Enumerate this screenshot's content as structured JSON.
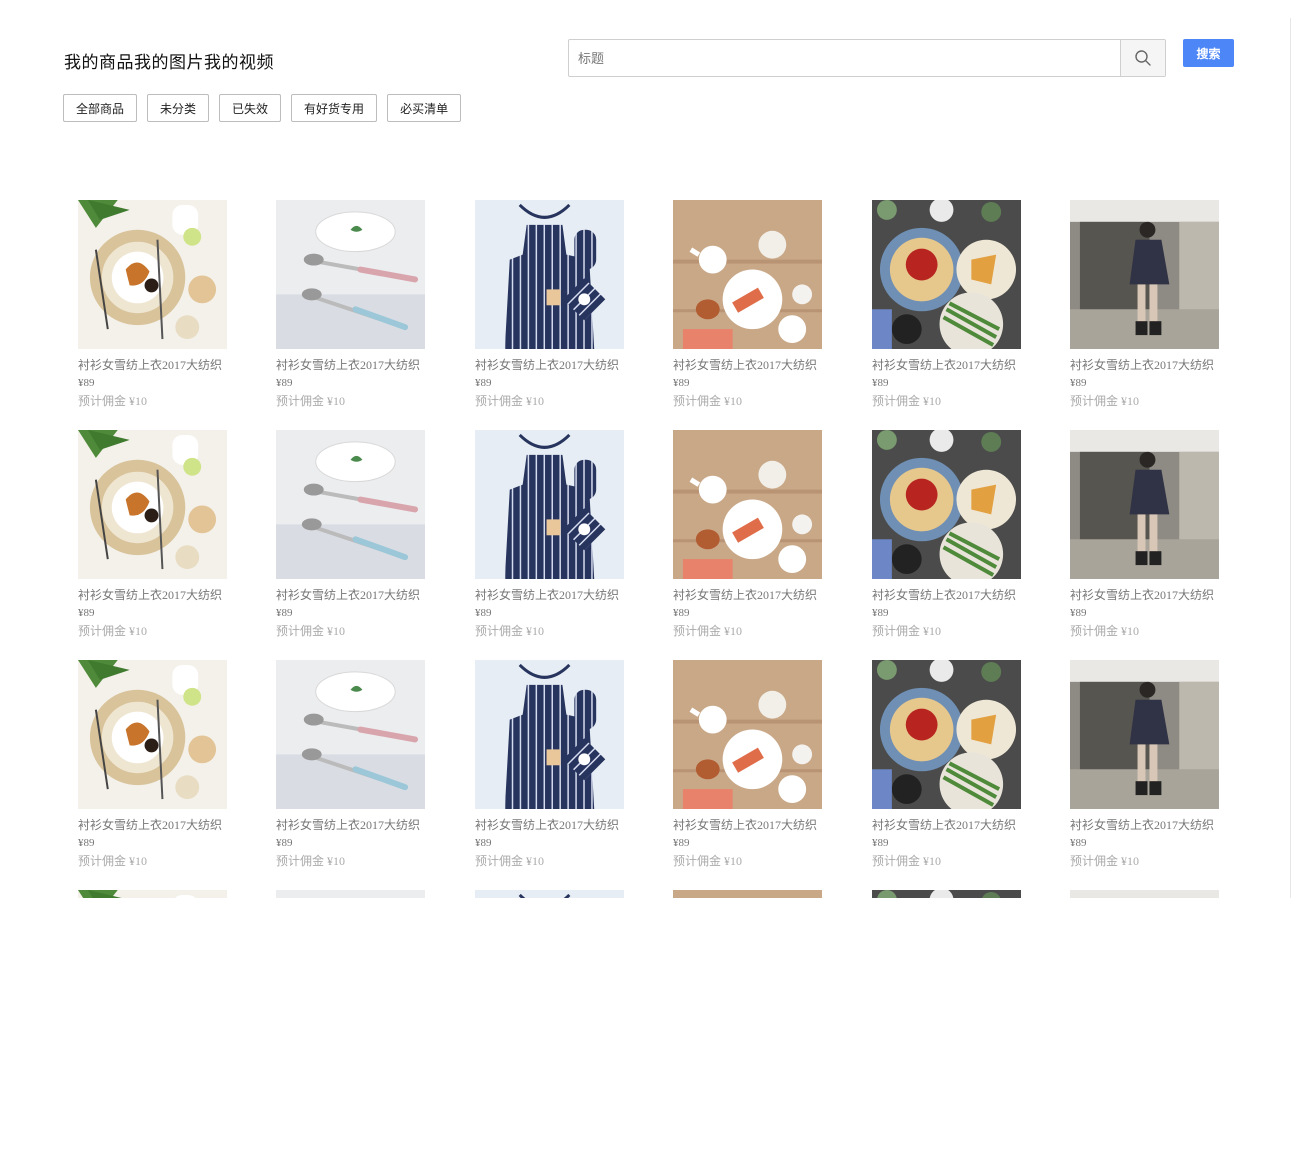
{
  "page_title": "我的商品我的图片我的视频",
  "search": {
    "placeholder": "标题",
    "submit_label": "搜索"
  },
  "filters": [
    "全部商品",
    "未分类",
    "已失效",
    "有好货专用",
    "必买清单"
  ],
  "product_types": [
    "breakfast-croissant",
    "tableware-spoons",
    "striped-apron",
    "tea-table",
    "food-plates",
    "woman-photo"
  ],
  "products": [
    {
      "title": "衬衫女雪纺上衣2017大纺织",
      "price": "¥89",
      "commission": "预计佣金 ¥10"
    },
    {
      "title": "衬衫女雪纺上衣2017大纺织",
      "price": "¥89",
      "commission": "预计佣金 ¥10"
    },
    {
      "title": "衬衫女雪纺上衣2017大纺织",
      "price": "¥89",
      "commission": "预计佣金 ¥10"
    },
    {
      "title": "衬衫女雪纺上衣2017大纺织",
      "price": "¥89",
      "commission": "预计佣金 ¥10"
    },
    {
      "title": "衬衫女雪纺上衣2017大纺织",
      "price": "¥89",
      "commission": "预计佣金 ¥10"
    },
    {
      "title": "衬衫女雪纺上衣2017大纺织",
      "price": "¥89",
      "commission": "预计佣金 ¥10"
    },
    {
      "title": "衬衫女雪纺上衣2017大纺织",
      "price": "¥89",
      "commission": "预计佣金 ¥10"
    },
    {
      "title": "衬衫女雪纺上衣2017大纺织",
      "price": "¥89",
      "commission": "预计佣金 ¥10"
    },
    {
      "title": "衬衫女雪纺上衣2017大纺织",
      "price": "¥89",
      "commission": "预计佣金 ¥10"
    },
    {
      "title": "衬衫女雪纺上衣2017大纺织",
      "price": "¥89",
      "commission": "预计佣金 ¥10"
    },
    {
      "title": "衬衫女雪纺上衣2017大纺织",
      "price": "¥89",
      "commission": "预计佣金 ¥10"
    },
    {
      "title": "衬衫女雪纺上衣2017大纺织",
      "price": "¥89",
      "commission": "预计佣金 ¥10"
    },
    {
      "title": "衬衫女雪纺上衣2017大纺织",
      "price": "¥89",
      "commission": "预计佣金 ¥10"
    },
    {
      "title": "衬衫女雪纺上衣2017大纺织",
      "price": "¥89",
      "commission": "预计佣金 ¥10"
    },
    {
      "title": "衬衫女雪纺上衣2017大纺织",
      "price": "¥89",
      "commission": "预计佣金 ¥10"
    },
    {
      "title": "衬衫女雪纺上衣2017大纺织",
      "price": "¥89",
      "commission": "预计佣金 ¥10"
    },
    {
      "title": "衬衫女雪纺上衣2017大纺织",
      "price": "¥89",
      "commission": "预计佣金 ¥10"
    },
    {
      "title": "衬衫女雪纺上衣2017大纺织",
      "price": "¥89",
      "commission": "预计佣金 ¥10"
    }
  ],
  "colors": {
    "accent": "#4d86f7"
  }
}
